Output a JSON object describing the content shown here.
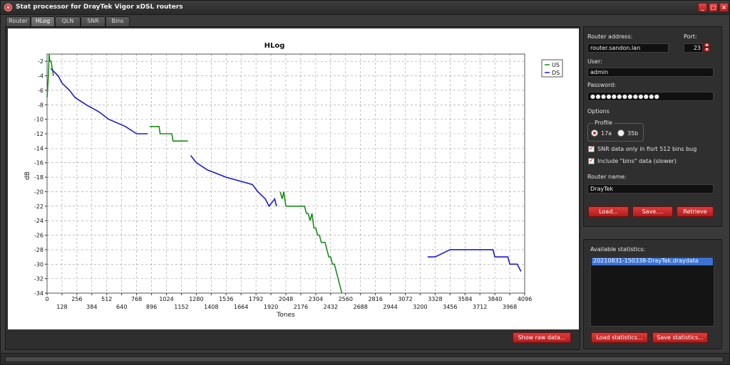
{
  "window": {
    "title": "Stat processor for DrayTek Vigor xDSL routers",
    "buttons": {
      "minimize": "_",
      "maximize": "□",
      "close": "×"
    }
  },
  "tabs": [
    {
      "label": "Router"
    },
    {
      "label": "HLog"
    },
    {
      "label": "QLN"
    },
    {
      "label": "SNR"
    },
    {
      "label": "Bins"
    }
  ],
  "active_tab": "HLog",
  "chart_data": {
    "type": "line",
    "title": "HLog",
    "xlabel": "Tones",
    "ylabel": "dB",
    "xlim": [
      0,
      4096
    ],
    "ylim": [
      -34,
      -1
    ],
    "x_ticks_top_row": [
      "0",
      "256",
      "512",
      "768",
      "1024",
      "1280",
      "1536",
      "1792",
      "2048",
      "2304",
      "2560",
      "2816",
      "3072",
      "3328",
      "3584",
      "3840",
      "4096"
    ],
    "x_ticks_bottom_row": [
      "128",
      "384",
      "640",
      "896",
      "1152",
      "1408",
      "1664",
      "1920",
      "2176",
      "2432",
      "2688",
      "2944",
      "3200",
      "3456",
      "3712",
      "3968"
    ],
    "y_ticks": [
      "-2",
      "-4",
      "-6",
      "-8",
      "-10",
      "-12",
      "-14",
      "-16",
      "-18",
      "-20",
      "-22",
      "-24",
      "-26",
      "-28",
      "-30",
      "-32",
      "-34"
    ],
    "grid": true,
    "legend_position": "top-right",
    "series": [
      {
        "name": "US",
        "color": "#1a8c1a",
        "segments": [
          [
            [
              0,
              -7
            ],
            [
              8,
              -5
            ],
            [
              14,
              -3
            ],
            [
              18,
              -1
            ],
            [
              24,
              -2
            ],
            [
              34,
              -2
            ],
            [
              45,
              -3
            ],
            [
              55,
              -4
            ]
          ],
          [
            [
              880,
              -11
            ],
            [
              960,
              -11
            ],
            [
              970,
              -12
            ],
            [
              1070,
              -12
            ],
            [
              1080,
              -13
            ],
            [
              1208,
              -13
            ]
          ],
          [
            [
              2000,
              -20
            ],
            [
              2016,
              -21
            ],
            [
              2030,
              -20
            ],
            [
              2048,
              -22
            ],
            [
              2096,
              -22
            ],
            [
              2208,
              -22
            ],
            [
              2224,
              -23
            ],
            [
              2240,
              -23
            ],
            [
              2256,
              -24
            ],
            [
              2272,
              -23
            ],
            [
              2288,
              -25
            ],
            [
              2304,
              -25
            ],
            [
              2320,
              -26
            ],
            [
              2336,
              -26
            ],
            [
              2352,
              -27
            ],
            [
              2384,
              -27
            ],
            [
              2400,
              -28
            ],
            [
              2416,
              -29
            ],
            [
              2432,
              -29
            ],
            [
              2448,
              -30
            ],
            [
              2464,
              -30
            ],
            [
              2480,
              -31
            ],
            [
              2496,
              -32
            ],
            [
              2512,
              -33
            ],
            [
              2528,
              -34
            ]
          ]
        ]
      },
      {
        "name": "DS",
        "color": "#1a1ad0",
        "segments": [
          [
            [
              32,
              -3
            ],
            [
              96,
              -4
            ],
            [
              128,
              -5
            ],
            [
              192,
              -6
            ],
            [
              240,
              -7
            ],
            [
              336,
              -8
            ],
            [
              448,
              -9
            ],
            [
              528,
              -10
            ],
            [
              672,
              -11
            ],
            [
              768,
              -12
            ],
            [
              864,
              -12
            ]
          ],
          [
            [
              1232,
              -15
            ],
            [
              1280,
              -16
            ],
            [
              1376,
              -17
            ],
            [
              1536,
              -18
            ],
            [
              1760,
              -19
            ],
            [
              1808,
              -20
            ],
            [
              1872,
              -21
            ],
            [
              1904,
              -22
            ],
            [
              1952,
              -21
            ],
            [
              1968,
              -22
            ]
          ],
          [
            [
              3264,
              -29
            ],
            [
              3328,
              -29
            ],
            [
              3456,
              -28
            ],
            [
              3584,
              -28
            ],
            [
              3824,
              -28
            ],
            [
              3840,
              -29
            ],
            [
              3952,
              -29
            ],
            [
              3968,
              -30
            ],
            [
              4032,
              -30
            ],
            [
              4064,
              -31
            ]
          ]
        ]
      }
    ]
  },
  "chart_footer": {
    "show_raw_button": "Show raw data..."
  },
  "router": {
    "address_label": "Router address:",
    "address_value": "router.sandon.lan",
    "port_label": "Port:",
    "port_value": "23",
    "user_label": "User:",
    "user_value": "admin",
    "password_label": "Password:",
    "password_value": "●●●●●●●●●●●●●",
    "options_label": "Options",
    "profile_label": "Profile",
    "profile_options": [
      "17a",
      "35b"
    ],
    "profile_selected": "17a",
    "checkbox_snr": "SNR data only in fisrt 512 bins bug",
    "checkbox_bins": "Include \"bins\" data (slower)",
    "name_label": "Router name:",
    "name_value": "DrayTek",
    "load_button": "Load...",
    "save_button": "Save....",
    "retrieve_button": "Retrieve"
  },
  "statistics": {
    "label": "Available statistics:",
    "items": [
      "20210831-150338-DrayTek.draydata"
    ],
    "load_button": "Load statistics...",
    "save_button": "Save statistics..."
  },
  "colors": {
    "accent": "#c22626",
    "selection": "#3c73d2",
    "background": "#3a3a3a"
  }
}
